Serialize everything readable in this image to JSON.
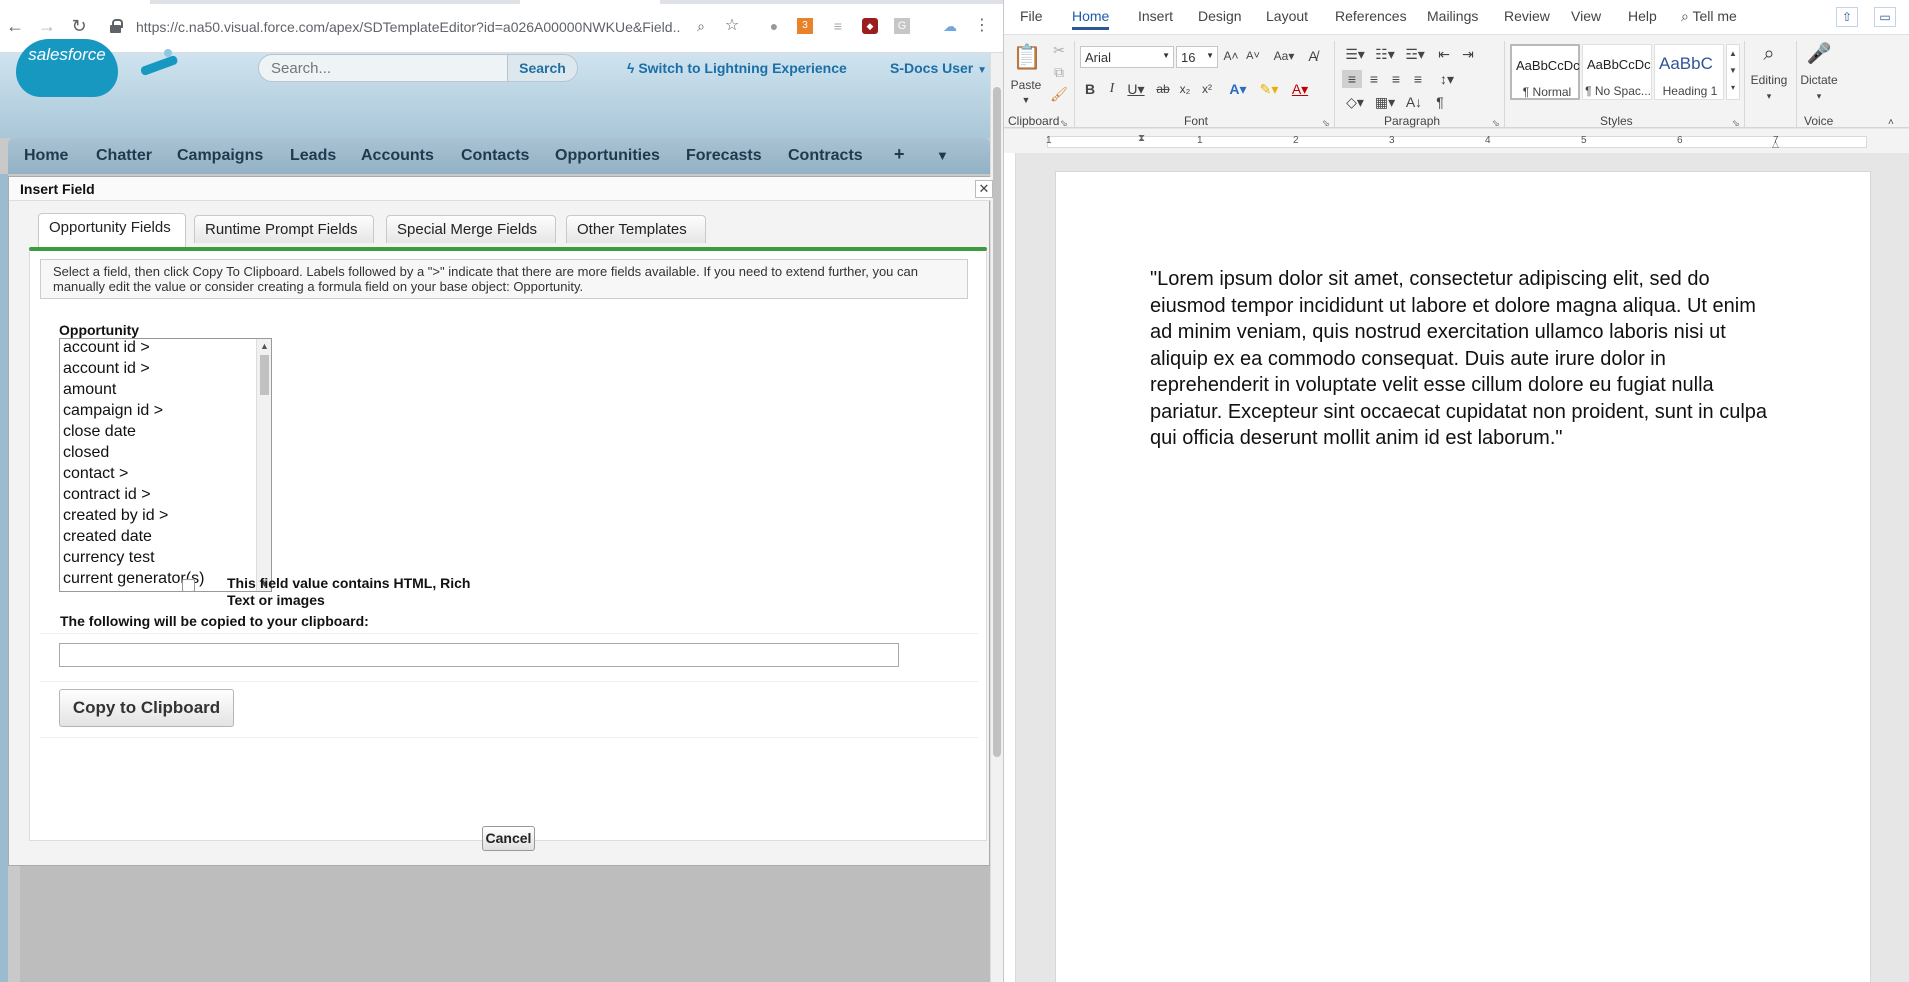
{
  "browser": {
    "url": "https://c.na50.visual.force.com/apex/SDTemplateEditor?id=a026A00000NWKUe&Field...",
    "extension_badge": "3"
  },
  "salesforce": {
    "logo_text": "salesforce",
    "search": {
      "placeholder": "Search...",
      "button_label": "Search"
    },
    "lightning_link": "Switch to Lightning Experience",
    "user_menu": "S-Docs User",
    "nav_tabs": [
      "Home",
      "Chatter",
      "Campaigns",
      "Leads",
      "Accounts",
      "Contacts",
      "Opportunities",
      "Forecasts",
      "Contracts"
    ],
    "nav_plus": "+",
    "nav_more": "▼"
  },
  "dialog": {
    "title": "Insert Field",
    "close": "✕",
    "tabs": [
      "Opportunity Fields",
      "Runtime Prompt Fields",
      "Special Merge Fields",
      "Other Templates"
    ],
    "active_tab": "Opportunity Fields",
    "instructions": "Select a field, then click Copy To Clipboard. Labels followed by a \">\" indicate that there are more fields available. If you need to extend further, you can manually edit the value or consider creating a formula field on your base object: Opportunity.",
    "object_label": "Opportunity",
    "fields": [
      "account id >",
      "account id >",
      "amount",
      "campaign id >",
      "close date",
      "closed",
      "contact >",
      "contract id >",
      "created by id >",
      "created date",
      "currency test",
      "current generator(s)"
    ],
    "html_checkbox_label": "This field value contains HTML, Rich Text or images",
    "html_checkbox_checked": false,
    "clipboard_label": "The following will be copied to your clipboard:",
    "clipboard_value": "",
    "copy_button": "Copy to Clipboard",
    "cancel_button": "Cancel"
  },
  "word": {
    "ribbon_tabs": [
      "File",
      "Home",
      "Insert",
      "Design",
      "Layout",
      "References",
      "Mailings",
      "Review",
      "View",
      "Help"
    ],
    "active_tab": "Home",
    "tell_me": "Tell me",
    "paste_label": "Paste",
    "font_name": "Arial",
    "font_size": "16",
    "styles": [
      {
        "sample": "AaBbCcDc",
        "name": "¶ Normal"
      },
      {
        "sample": "AaBbCcDc",
        "name": "¶ No Spac..."
      },
      {
        "sample": "AaBbC",
        "name": "Heading 1"
      }
    ],
    "editing_label": "Editing",
    "dictate_label": "Dictate",
    "groups": [
      "Clipboard",
      "Font",
      "Paragraph",
      "Styles",
      "Voice"
    ],
    "ruler_numbers": [
      "1",
      "1",
      "2",
      "3",
      "4",
      "5",
      "6",
      "7"
    ],
    "document_text": "\"Lorem ipsum dolor sit amet, consectetur adipiscing elit, sed do eiusmod tempor incididunt ut labore et dolore magna aliqua. Ut enim ad minim veniam, quis nostrud exercitation ullamco laboris nisi ut aliquip ex ea commodo consequat. Duis aute irure dolor in reprehenderit in voluptate velit esse cillum dolore eu fugiat nulla pariatur. Excepteur sint occaecat cupidatat non proident, sunt in culpa qui officia deserunt mollit anim id est laborum.\""
  },
  "colors": {
    "sf_blue": "#1798c1",
    "sf_link": "#1a6fa8",
    "sf_green_bar": "#3e9a3e",
    "word_blue": "#2b579a"
  }
}
